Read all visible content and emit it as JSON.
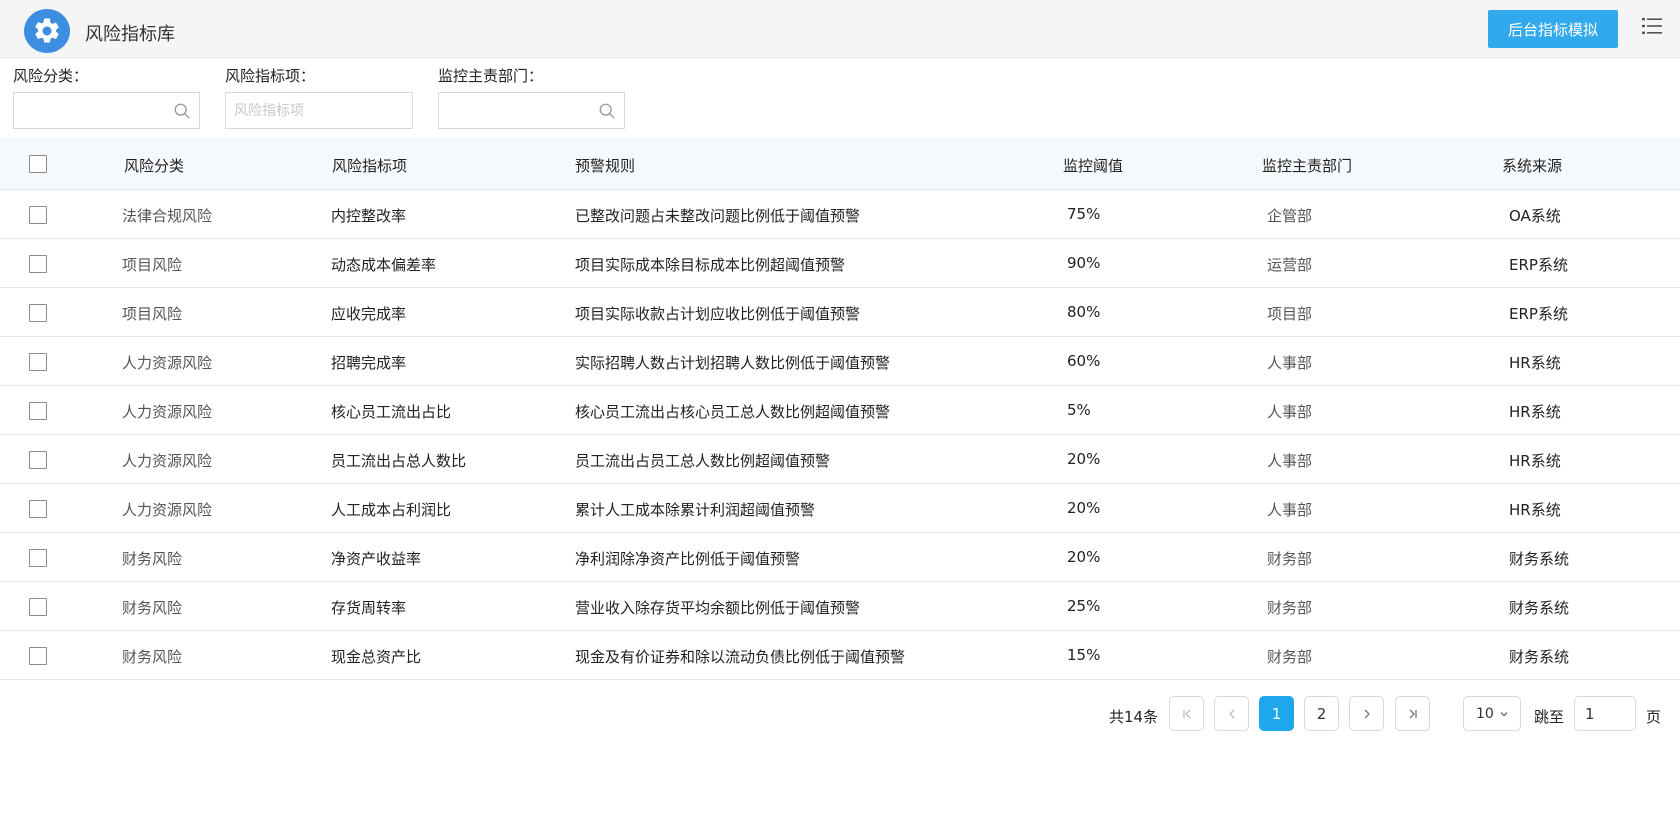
{
  "header": {
    "title": "风险指标库",
    "primary_button": "后台指标模拟"
  },
  "filters": [
    {
      "label": "风险分类：",
      "placeholder": "",
      "has_search_icon": true
    },
    {
      "label": "风险指标项：",
      "placeholder": "风险指标项",
      "has_search_icon": false
    },
    {
      "label": "监控主责部门：",
      "placeholder": "",
      "has_search_icon": true
    }
  ],
  "table": {
    "columns": [
      "风险分类",
      "风险指标项",
      "预警规则",
      "监控阈值",
      "监控主责部门",
      "系统来源"
    ],
    "rows": [
      {
        "category": "法律合规风险",
        "indicator": "内控整改率",
        "rule": "已整改问题占未整改问题比例低于阈值预警",
        "threshold": "75%",
        "department": "企管部",
        "source": "OA系统"
      },
      {
        "category": "项目风险",
        "indicator": "动态成本偏差率",
        "rule": "项目实际成本除目标成本比例超阈值预警",
        "threshold": "90%",
        "department": "运营部",
        "source": "ERP系统"
      },
      {
        "category": "项目风险",
        "indicator": "应收完成率",
        "rule": "项目实际收款占计划应收比例低于阈值预警",
        "threshold": "80%",
        "department": "项目部",
        "source": "ERP系统"
      },
      {
        "category": "人力资源风险",
        "indicator": "招聘完成率",
        "rule": "实际招聘人数占计划招聘人数比例低于阈值预警",
        "threshold": "60%",
        "department": "人事部",
        "source": "HR系统"
      },
      {
        "category": "人力资源风险",
        "indicator": "核心员工流出占比",
        "rule": "核心员工流出占核心员工总人数比例超阈值预警",
        "threshold": "5%",
        "department": "人事部",
        "source": "HR系统"
      },
      {
        "category": "人力资源风险",
        "indicator": "员工流出占总人数比",
        "rule": "员工流出占员工总人数比例超阈值预警",
        "threshold": "20%",
        "department": "人事部",
        "source": "HR系统"
      },
      {
        "category": "人力资源风险",
        "indicator": "人工成本占利润比",
        "rule": "累计人工成本除累计利润超阈值预警",
        "threshold": "20%",
        "department": "人事部",
        "source": "HR系统"
      },
      {
        "category": "财务风险",
        "indicator": "净资产收益率",
        "rule": "净利润除净资产比例低于阈值预警",
        "threshold": "20%",
        "department": "财务部",
        "source": "财务系统"
      },
      {
        "category": "财务风险",
        "indicator": "存货周转率",
        "rule": "营业收入除存货平均余额比例低于阈值预警",
        "threshold": "25%",
        "department": "财务部",
        "source": "财务系统"
      },
      {
        "category": "财务风险",
        "indicator": "现金总资产比",
        "rule": "现金及有价证券和除以流动负债比例低于阈值预警",
        "threshold": "15%",
        "department": "财务部",
        "source": "财务系统"
      }
    ]
  },
  "pagination": {
    "total_text": "共14条",
    "pages": [
      "1",
      "2"
    ],
    "current_page": "1",
    "page_size": "10",
    "jump_label": "跳至",
    "jump_value": "1",
    "page_suffix": "页"
  },
  "colors": {
    "accent": "#33a9ed",
    "active_page": "#1ea7ea",
    "logo": "#3d8ee0",
    "header_bg": "#f5f5f5"
  }
}
